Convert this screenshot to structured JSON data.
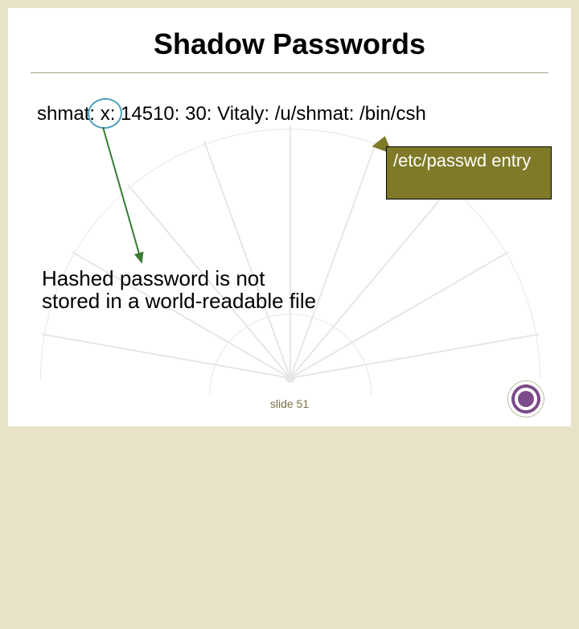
{
  "title": "Shadow Passwords",
  "passwd_line": "shmat: x: 14510: 30: Vitaly: /u/shmat: /bin/csh",
  "callout": "/etc/passwd entry",
  "explanation": "Hashed password is not\nstored in a world-readable file",
  "slide_label": "slide 51",
  "colors": {
    "border": "#e8e2c8",
    "callout_bg": "#7f7a28",
    "circle": "#4ca0bf",
    "arrow": "#3a7a33"
  }
}
